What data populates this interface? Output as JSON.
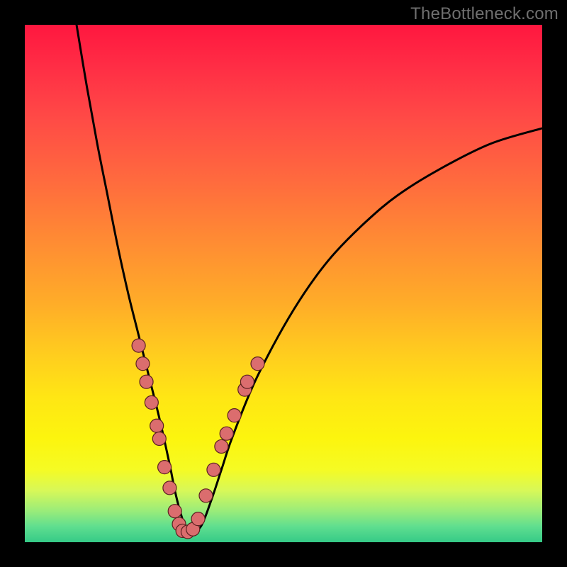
{
  "watermark": "TheBottleneck.com",
  "chart_data": {
    "type": "line",
    "title": "",
    "xlabel": "",
    "ylabel": "",
    "xlim": [
      0,
      100
    ],
    "ylim": [
      0,
      100
    ],
    "grid": false,
    "legend": false,
    "series": [
      {
        "name": "curve",
        "x": [
          10,
          12,
          14,
          16,
          18,
          20,
          22,
          24,
          26,
          28,
          29,
          30,
          31,
          32,
          34,
          36,
          38,
          40,
          44,
          48,
          52,
          56,
          60,
          66,
          72,
          80,
          90,
          100
        ],
        "y": [
          100,
          88,
          77,
          67,
          57,
          48,
          40,
          32,
          24,
          15,
          10,
          6,
          3,
          2,
          3,
          8,
          14,
          20,
          30,
          38,
          45,
          51,
          56,
          62,
          67,
          72,
          77,
          80
        ]
      }
    ],
    "markers": {
      "name": "highlighted-points",
      "points": [
        {
          "x": 22.0,
          "y": 38.0
        },
        {
          "x": 22.8,
          "y": 34.5
        },
        {
          "x": 23.5,
          "y": 31.0
        },
        {
          "x": 24.5,
          "y": 27.0
        },
        {
          "x": 25.5,
          "y": 22.5
        },
        {
          "x": 26.0,
          "y": 20.0
        },
        {
          "x": 27.0,
          "y": 14.5
        },
        {
          "x": 28.0,
          "y": 10.5
        },
        {
          "x": 29.0,
          "y": 6.0
        },
        {
          "x": 29.8,
          "y": 3.5
        },
        {
          "x": 30.5,
          "y": 2.2
        },
        {
          "x": 31.5,
          "y": 2.0
        },
        {
          "x": 32.5,
          "y": 2.5
        },
        {
          "x": 33.5,
          "y": 4.5
        },
        {
          "x": 35.0,
          "y": 9.0
        },
        {
          "x": 36.5,
          "y": 14.0
        },
        {
          "x": 38.0,
          "y": 18.5
        },
        {
          "x": 39.0,
          "y": 21.0
        },
        {
          "x": 40.5,
          "y": 24.5
        },
        {
          "x": 42.5,
          "y": 29.5
        },
        {
          "x": 43.0,
          "y": 31.0
        },
        {
          "x": 45.0,
          "y": 34.5
        }
      ]
    }
  }
}
